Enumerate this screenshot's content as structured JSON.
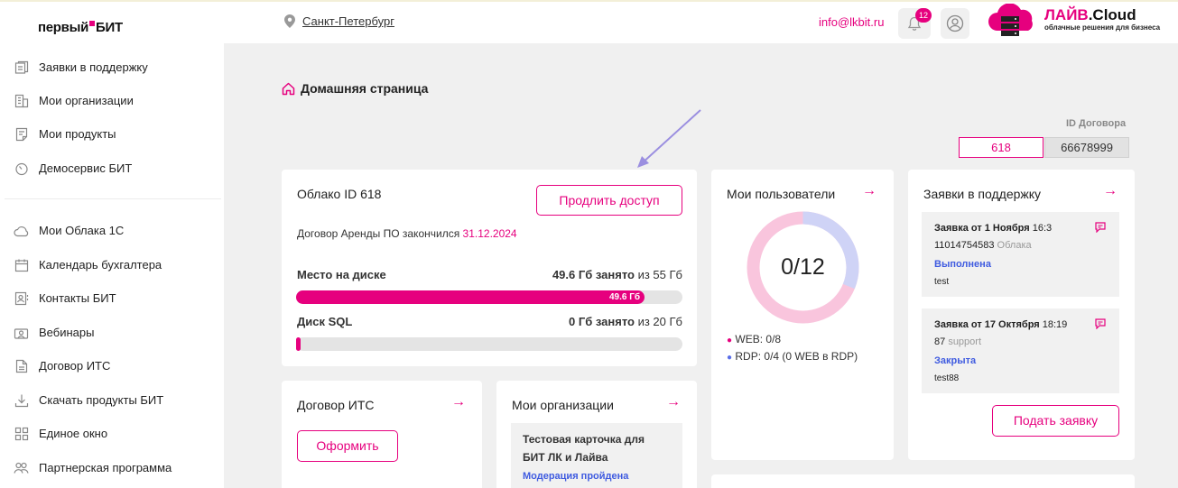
{
  "header": {
    "logo_part1": "первый",
    "logo_part2": "БИТ",
    "city": "Санкт-Петербург",
    "email": "info@lkbit.ru",
    "notifications_count": "12",
    "brand_name_a": "ЛАЙВ",
    "brand_name_b": ".Cloud",
    "brand_tagline": "облачные решения для бизнеса",
    "accent_color": "#e6007e"
  },
  "sidebar": {
    "items": [
      {
        "label": "Заявки в поддержку",
        "icon": "tickets-icon"
      },
      {
        "label": "Мои организации",
        "icon": "building-icon"
      },
      {
        "label": "Мои продукты",
        "icon": "products-icon"
      },
      {
        "label": "Демосервис БИТ",
        "icon": "timer-icon"
      },
      {
        "label": "Мои Облака 1С",
        "icon": "cloud-icon"
      },
      {
        "label": "Календарь бухгалтера",
        "icon": "calendar-icon"
      },
      {
        "label": "Контакты БИТ",
        "icon": "contacts-icon"
      },
      {
        "label": "Вебинары",
        "icon": "webinar-icon"
      },
      {
        "label": "Договор ИТС",
        "icon": "document-icon"
      },
      {
        "label": "Скачать продукты БИТ",
        "icon": "download-icon"
      },
      {
        "label": "Единое окно",
        "icon": "grid-icon"
      },
      {
        "label": "Партнерская программа",
        "icon": "partners-icon"
      }
    ]
  },
  "breadcrumb": {
    "title": "Домашняя страница"
  },
  "contract": {
    "label": "ID Договора",
    "id": "618",
    "number": "66678999"
  },
  "cloud_card": {
    "title": "Облако ID 618",
    "extend_button": "Продлить доступ",
    "lease_text": "Договор Аренды ПО закончился",
    "lease_date": "31.12.2024",
    "disk_label": "Место на диске",
    "disk_used": "49.6 Гб занято",
    "disk_total": "из 55 Гб",
    "disk_bar_label": "49.6 Гб",
    "disk_fraction": 0.902,
    "sql_label": "Диск SQL",
    "sql_used": "0 Гб занято",
    "sql_total": "из 20 Гб",
    "sql_fraction": 0
  },
  "users_card": {
    "title": "Мои пользователи",
    "count": "0/12",
    "web_stat": "WEB: 0/8",
    "rdp_stat": "RDP: 0/4 (0 WEB в RDP)",
    "web_color": "#e6007e",
    "rdp_color": "#5a6ee8"
  },
  "support_card": {
    "title": "Заявки в поддержку",
    "tickets": [
      {
        "title": "Заявка от 1 Ноября",
        "time": "16:3",
        "number": "11014754583",
        "category": "Облака",
        "status": "Выполнена",
        "description": "test"
      },
      {
        "title": "Заявка от 17 Октября",
        "time": "18:19",
        "number": "87",
        "category": "support",
        "status": "Закрыта",
        "description": "test88"
      }
    ],
    "submit_button": "Подать заявку"
  },
  "its_card": {
    "title": "Договор ИТС",
    "button": "Оформить"
  },
  "orgs_card": {
    "title": "Мои организации",
    "org_name_line1": "Тестовая карточка для",
    "org_name_line2": "БИТ ЛК и Лайва",
    "org_status": "Модерация пройдена"
  }
}
